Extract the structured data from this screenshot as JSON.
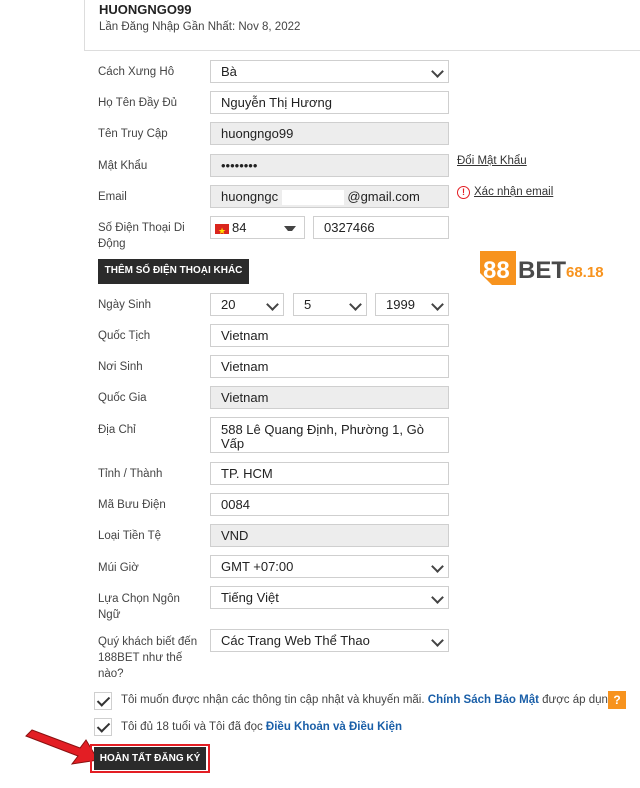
{
  "account": {
    "username": "HUONGNGO99",
    "last_login": "Lần Đăng Nhập Gần Nhất: Nov 8, 2022"
  },
  "form": {
    "title_label": "Cách Xưng Hô",
    "title_value": "Bà",
    "fullname_label": "Họ Tên Đầy Đủ",
    "fullname_value": "Nguyễn Thị Hương",
    "login_label": "Tên Truy Cập",
    "login_value": "huongngo99",
    "password_label": "Mật Khẩu",
    "password_value": "••••••••",
    "change_password": "Đổi Mật Khẩu",
    "email_label": "Email",
    "email_value_prefix": "huongngc",
    "email_value_suffix": "@gmail.com",
    "confirm_email": "Xác nhận email",
    "phone_label_1": "Số Điện Thoại Di",
    "phone_label_2": "Động",
    "phone_code": "84",
    "phone_value": "0327466",
    "add_phone_button": "THÊM SỐ ĐIỆN THOẠI KHÁC",
    "dob_label": "Ngày Sinh",
    "dob_day": "20",
    "dob_month": "5",
    "dob_year": "1999",
    "nationality_label": "Quốc Tịch",
    "nationality_value": "Vietnam",
    "birthplace_label": "Nơi Sinh",
    "birthplace_value": "Vietnam",
    "country_label": "Quốc Gia",
    "country_value": "Vietnam",
    "address_label": "Địa Chỉ",
    "address_line1": "588 Lê Quang Định, Phường 1, Gò",
    "address_line2": "Vấp",
    "city_label": "Tỉnh / Thành",
    "city_value": "TP. HCM",
    "postal_label": "Mã Bưu Điện",
    "postal_value": "0084",
    "currency_label": "Loại Tiền Tệ",
    "currency_value": "VND",
    "timezone_label": "Múi Giờ",
    "timezone_value": "GMT +07:00",
    "language_label_1": "Lựa Chọn Ngôn",
    "language_label_2": "Ngữ",
    "language_value": "Tiếng Việt",
    "referral_label_1": "Quý khách biết đến",
    "referral_label_2": "188BET như thế",
    "referral_label_3": "nào?",
    "referral_value": "Các Trang Web Thể Thao"
  },
  "consent": {
    "updates_text": "Tôi muốn được nhận các thông tin cập nhật và khuyến mãi.",
    "privacy_link": "Chính Sách Bảo Mật",
    "updates_suffix": "được áp dụng.",
    "help_badge": "?",
    "age_text": "Tôi đủ 18 tuổi và Tôi đã đọc",
    "terms_link": "Điều Khoản và Điều Kiện"
  },
  "submit_button": "HOÀN TẤT ĐĂNG KÝ",
  "logo": {
    "num": "88",
    "bet": "BET",
    "suffix": "68.183"
  },
  "colors": {
    "accent_orange": "#f7931e",
    "highlight_red": "#e31e24",
    "link_blue": "#1a5fa8",
    "dark_button": "#2b2b2b"
  }
}
